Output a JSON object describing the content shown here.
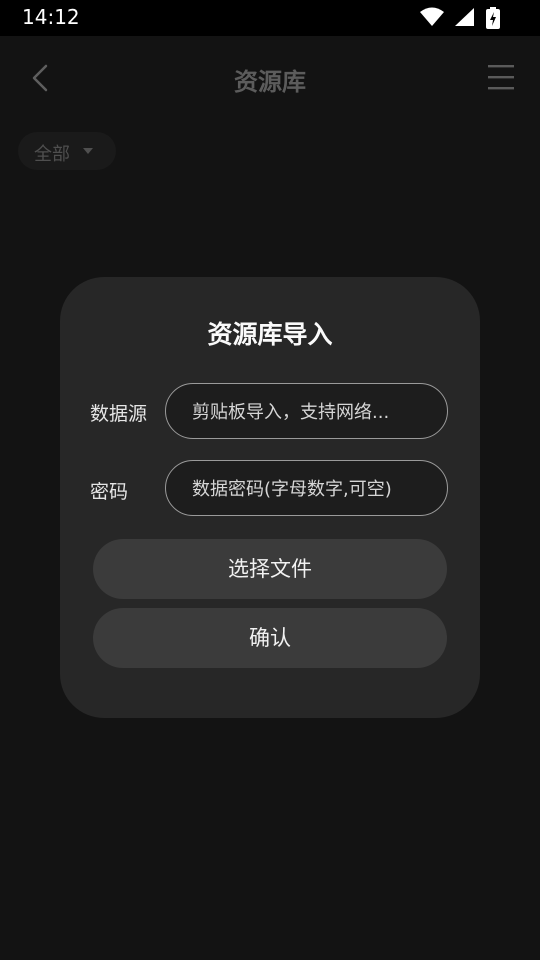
{
  "status_bar": {
    "time": "14:12"
  },
  "app_bar": {
    "title": "资源库"
  },
  "filter": {
    "label": "全部"
  },
  "dialog": {
    "title": "资源库导入",
    "source": {
      "label": "数据源",
      "placeholder": "剪贴板导入，支持网络..."
    },
    "password": {
      "label": "密码",
      "placeholder": "数据密码(字母数字,可空)"
    },
    "choose_file_label": "选择文件",
    "confirm_label": "确认"
  }
}
